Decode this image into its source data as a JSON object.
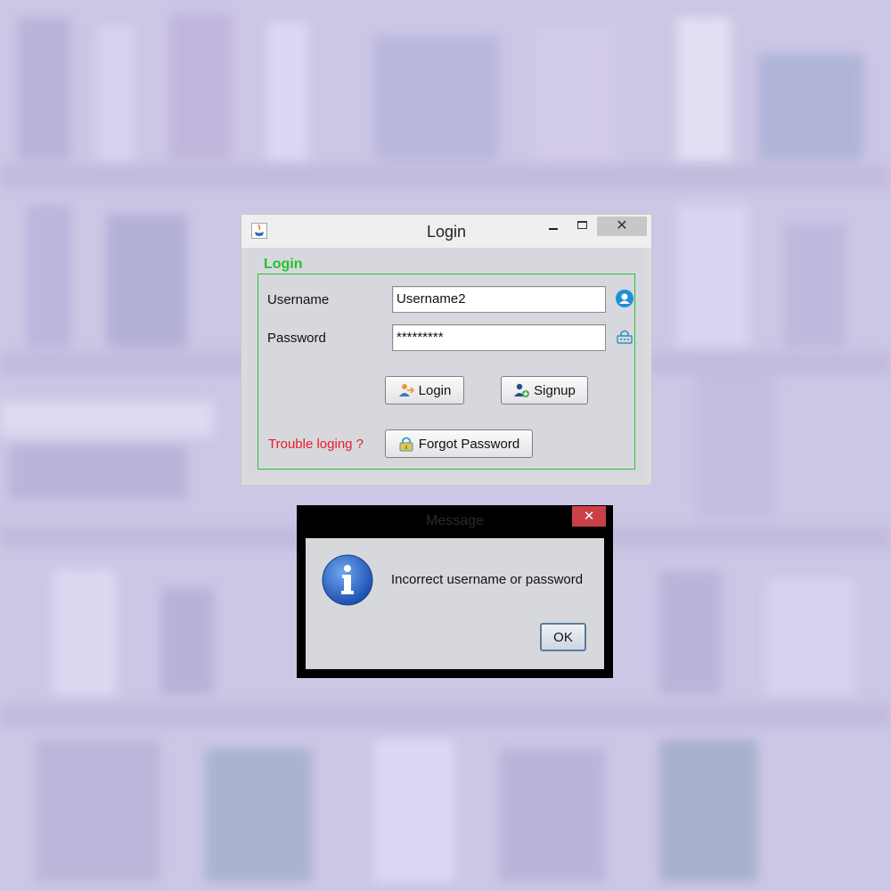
{
  "login_window": {
    "title": "Login",
    "close_label": "✕",
    "group_title": "Login",
    "username": {
      "label": "Username",
      "value": "Username2"
    },
    "password": {
      "label": "Password",
      "value": "*********"
    },
    "login_button": "Login",
    "signup_button": "Signup",
    "trouble_text": "Trouble loging ?",
    "forgot_button": "Forgot Password",
    "icons": [
      "java-icon",
      "user-icon",
      "lock-icon",
      "login-icon",
      "add-user-icon",
      "forgot-lock-icon"
    ],
    "colors": {
      "group_title": "#1ec32a",
      "group_border": "#25c13a",
      "trouble_text": "#ec1c24"
    }
  },
  "message_dialog": {
    "title": "Message",
    "close_label": "✕",
    "text": "Incorrect username or password",
    "ok_button": "OK",
    "icon": "info-icon"
  }
}
